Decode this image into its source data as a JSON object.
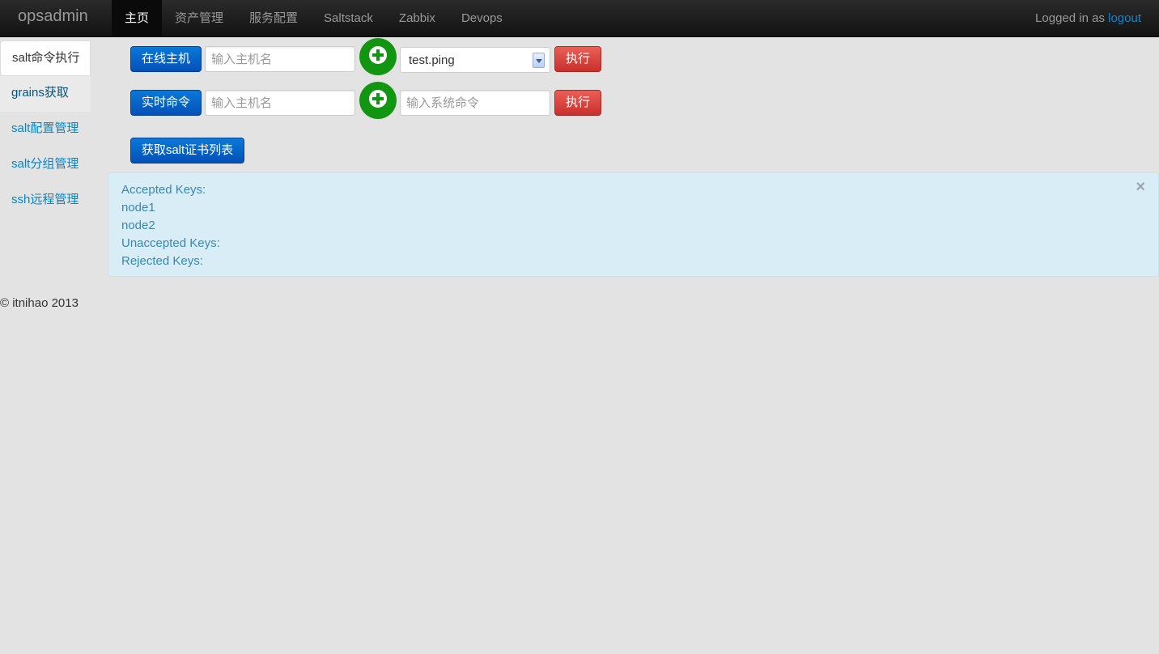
{
  "navbar": {
    "brand": "opsadmin",
    "items": [
      {
        "label": "主页",
        "active": true
      },
      {
        "label": "资产管理"
      },
      {
        "label": "服务配置"
      },
      {
        "label": "Saltstack"
      },
      {
        "label": "Zabbix"
      },
      {
        "label": "Devops"
      }
    ],
    "logged_in_text": "Logged in as",
    "logout_label": "logout"
  },
  "sidebar": {
    "items": [
      {
        "label": "salt命令执行",
        "active": true
      },
      {
        "label": "grains获取"
      },
      {
        "label": "salt配置管理"
      },
      {
        "label": "salt分组管理"
      },
      {
        "label": "ssh远程管理"
      }
    ]
  },
  "row1": {
    "button_label": "在线主机",
    "host_placeholder": "输入主机名",
    "plus_icon": "plus-circle-icon",
    "select_value": "test.ping",
    "exec_label": "执行"
  },
  "row2": {
    "button_label": "实时命令",
    "host_placeholder": "输入主机名",
    "plus_icon": "plus-circle-icon",
    "command_placeholder": "输入系统命令",
    "exec_label": "执行"
  },
  "cert_button_label": "获取salt证书列表",
  "alert": {
    "lines": [
      "Accepted Keys:",
      "node1",
      "node2",
      "Unaccepted Keys:",
      "Rejected Keys:"
    ],
    "close_label": "×"
  },
  "footer": "© itnihao 2013",
  "colors": {
    "navbar_bg": "#1b1b1b",
    "primary": "#0450b8",
    "danger": "#c9302c",
    "success": "#129612",
    "alert_bg": "#d9edf7",
    "link": "#0088cc"
  }
}
